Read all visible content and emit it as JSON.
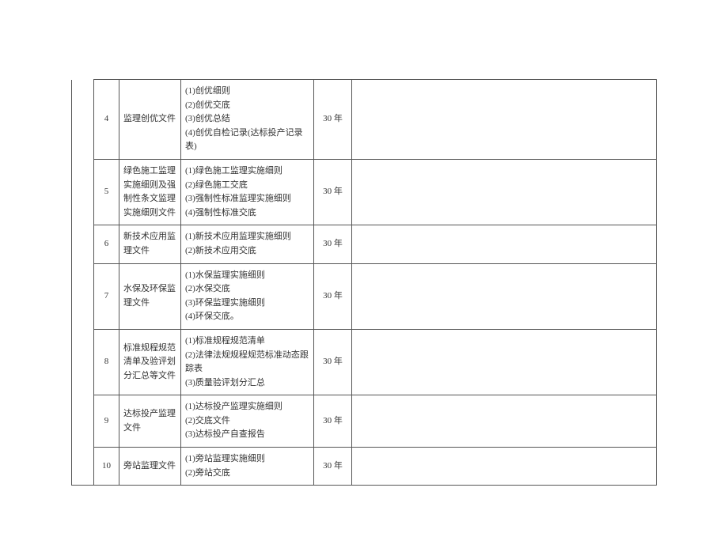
{
  "period_label": "30 年",
  "rows": [
    {
      "no": "4",
      "name": "监理创优文件",
      "details": "(1)创优细则\n(2)创优交底\n(3)创优总结\n(4)创优自检记录(达标投产记录表)",
      "period": "30 年",
      "note": ""
    },
    {
      "no": "5",
      "name": "绿色施工监理实施细则及强制性条文监理实施细则文件",
      "details": "(1)绿色施工监理实施细则\n(2)绿色施工交底\n(3)强制性标准监理实施细则\n(4)强制性标准交底",
      "period": "30 年",
      "note": ""
    },
    {
      "no": "6",
      "name": "新技术应用监理文件",
      "details": "(1)新技术应用监理实施细则\n(2)新技术应用交底",
      "period": "30 年",
      "note": ""
    },
    {
      "no": "7",
      "name": "水保及环保监理文件",
      "details": "(1)水保监理实施细则\n(2)水保交底\n(3)环保监理实施细则\n(4)环保交底。",
      "period": "30 年",
      "note": ""
    },
    {
      "no": "8",
      "name": "标准规程规范清单及验评划分汇总等文件",
      "details": "(1)标准规程规范清单\n(2)法律法规规程规范标准动态跟踪表\n(3)质量验评划分汇总",
      "period": "30 年",
      "note": ""
    },
    {
      "no": "9",
      "name": "达标投产监理文件",
      "details": "(1)达标投产监理实施细则\n(2)交底文件\n(3)达标投产自查报告",
      "period": "30 年",
      "note": ""
    },
    {
      "no": "10",
      "name": "旁站监理文件",
      "details": "(1)旁站监理实施细则\n(2)旁站交底",
      "period": "30 年",
      "note": ""
    }
  ]
}
